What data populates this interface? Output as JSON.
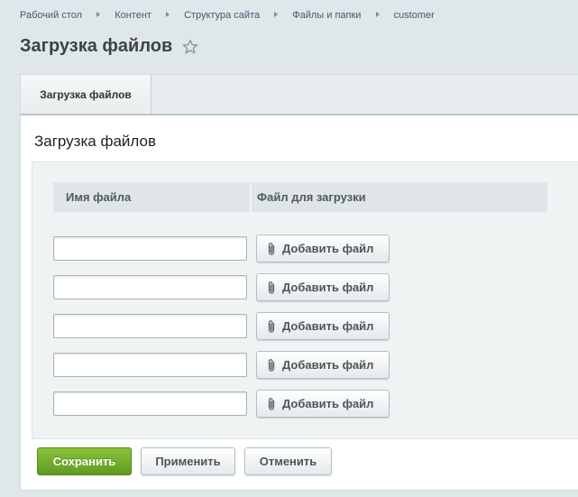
{
  "breadcrumb": [
    "Рабочий стол",
    "Контент",
    "Структура сайта",
    "Файлы и папки",
    "customer"
  ],
  "page": {
    "title": "Загрузка файлов"
  },
  "tabs": [
    {
      "label": "Загрузка файлов",
      "active": true
    }
  ],
  "section": {
    "title": "Загрузка файлов"
  },
  "table": {
    "columns": [
      "Имя файла",
      "Файл для загрузки"
    ],
    "rows": [
      {
        "name_value": "",
        "add_label": "Добавить файл"
      },
      {
        "name_value": "",
        "add_label": "Добавить файл"
      },
      {
        "name_value": "",
        "add_label": "Добавить файл"
      },
      {
        "name_value": "",
        "add_label": "Добавить файл"
      },
      {
        "name_value": "",
        "add_label": "Добавить файл"
      }
    ]
  },
  "buttons": {
    "save": "Сохранить",
    "apply": "Применить",
    "cancel": "Отменить"
  },
  "icons": {
    "favorite": "star-outline-icon",
    "attach": "paperclip-icon"
  },
  "colors": {
    "save_green": "#6aa82a",
    "background": "#e0e7ea"
  }
}
